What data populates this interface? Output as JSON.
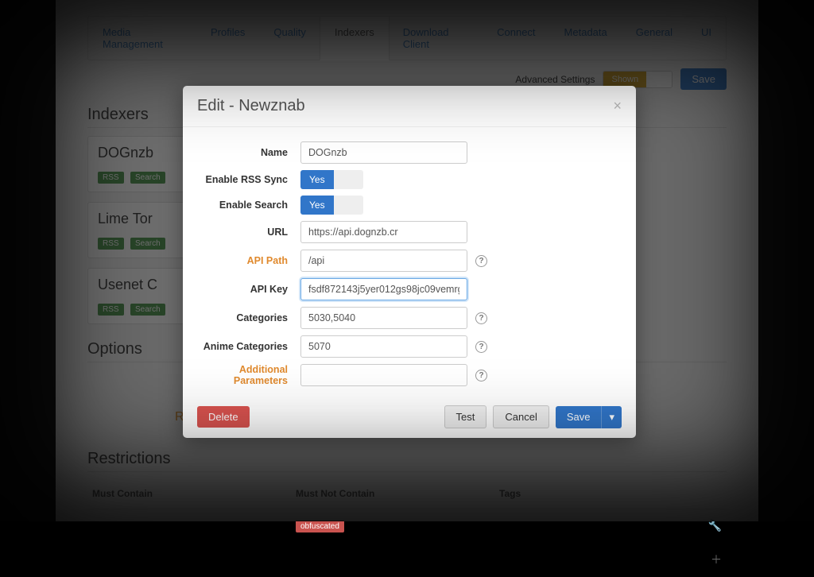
{
  "nav": {
    "tabs": [
      {
        "label": "Media Management"
      },
      {
        "label": "Profiles"
      },
      {
        "label": "Quality"
      },
      {
        "label": "Indexers",
        "active": true
      },
      {
        "label": "Download Client"
      },
      {
        "label": "Connect"
      },
      {
        "label": "Metadata"
      },
      {
        "label": "General"
      },
      {
        "label": "UI"
      }
    ],
    "advanced_label": "Advanced Settings",
    "advanced_state": "Shown",
    "save_label": "Save"
  },
  "sections": {
    "indexers": "Indexers",
    "options": "Options",
    "restrictions": "Restrictions"
  },
  "indexers": [
    {
      "name": "DOGnzb",
      "badges": [
        "RSS",
        "Search"
      ]
    },
    {
      "name": "Lime Tor",
      "badges": [
        "RSS",
        "Search"
      ]
    },
    {
      "name": "Usenet C",
      "badges": [
        "RSS",
        "Search"
      ]
    }
  ],
  "options": {
    "partial": "R"
  },
  "restrictions": {
    "headers": [
      "Must Contain",
      "Must Not Contain",
      "Tags"
    ],
    "rows": [
      {
        "must": "",
        "mustnot_badge": "obfuscated",
        "tags": ""
      }
    ]
  },
  "modal": {
    "title": "Edit - Newznab",
    "fields": {
      "name": {
        "label": "Name",
        "value": "DOGnzb"
      },
      "rss": {
        "label": "Enable RSS Sync",
        "value": "Yes"
      },
      "search": {
        "label": "Enable Search",
        "value": "Yes"
      },
      "url": {
        "label": "URL",
        "value": "https://api.dognzb.cr"
      },
      "apipath": {
        "label": "API Path",
        "value": "/api",
        "advanced": true
      },
      "apikey": {
        "label": "API Key",
        "value": "fsdf872143j5yer012gs98jc09vemrg"
      },
      "categories": {
        "label": "Categories",
        "value": "5030,5040"
      },
      "anime": {
        "label": "Anime Categories",
        "value": "5070"
      },
      "addl": {
        "label": "Additional Parameters",
        "value": "",
        "advanced": true
      }
    },
    "buttons": {
      "delete": "Delete",
      "test": "Test",
      "cancel": "Cancel",
      "save": "Save"
    }
  }
}
